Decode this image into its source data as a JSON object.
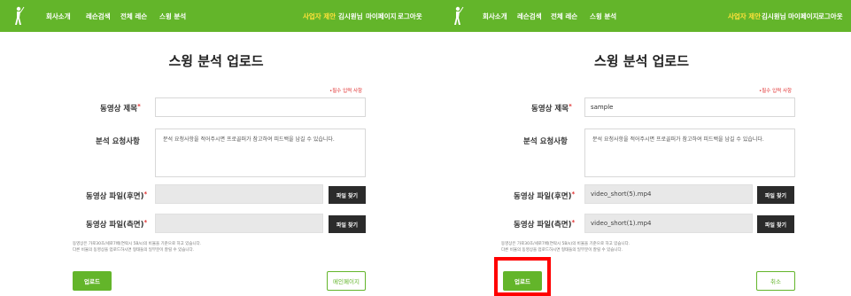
{
  "nav": {
    "items": [
      "회사소개",
      "레슨검색",
      "전체 레슨",
      "스윙 분석"
    ],
    "user_items": [
      "사업자 제안",
      "김시원님",
      "마이페이지",
      "로그아웃"
    ]
  },
  "form": {
    "title": "스윙 분석 업로드",
    "required_note": "•필수 입력 사항",
    "video_title_label": "동영상 제목",
    "request_label": "분석 요청사항",
    "request_placeholder": "분석 요청사항을 적어주시면 프로골퍼가 참고하여 피드백을 남길 수 있습니다.",
    "file_back_label": "동영상 파일(후면)",
    "file_side_label": "동영상 파일(측면)",
    "find_file_button": "파일 찾기",
    "help_line1": "동영상은 가로30초/세로7배(연락시 5B/s)의 비율을 기준으로 하고 있습니다.",
    "help_line2": "다른 비율의 동영상을 업로드하시면 형태들의 일부분이 잘릴 수 있습니다."
  },
  "left": {
    "video_title_value": "",
    "file_back_value": "",
    "file_side_value": "",
    "upload_button": "업로드",
    "main_page_button": "메인페이지"
  },
  "right": {
    "video_title_value": "sample",
    "file_back_value": "video_short(5).mp4",
    "file_side_value": "video_short(1).mp4",
    "upload_button": "업로드",
    "cancel_button": "취소"
  },
  "colors": {
    "brand_green": "#63b52a",
    "accent_yellow": "#ffe23a",
    "required_red": "#e03030",
    "highlight_red": "#ff0000"
  }
}
